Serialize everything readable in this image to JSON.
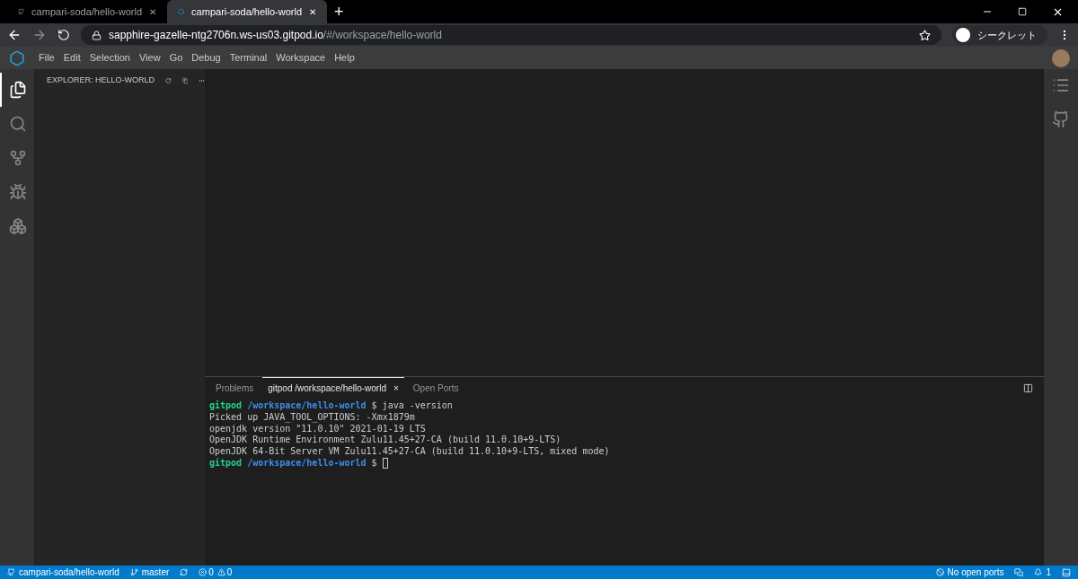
{
  "browser": {
    "tabs": [
      {
        "title": "campari-soda/hello-world",
        "kind": "github",
        "selected": false,
        "close": "✕"
      },
      {
        "title": "campari-soda/hello-world",
        "kind": "gitpod",
        "selected": true,
        "close": "✕"
      }
    ],
    "new_tab": "+",
    "url": {
      "host": "sapphire-gazelle-ntg2706n.ws-us03.gitpod.io",
      "path": "/#/workspace/hello-world"
    },
    "incognito": "シークレット"
  },
  "menu": [
    "File",
    "Edit",
    "Selection",
    "View",
    "Go",
    "Debug",
    "Terminal",
    "Workspace",
    "Help"
  ],
  "activity_bar": [
    {
      "kind": "files",
      "selected": true
    },
    {
      "kind": "search",
      "selected": false
    },
    {
      "kind": "git",
      "selected": false
    },
    {
      "kind": "debug",
      "selected": false
    },
    {
      "kind": "extensions",
      "selected": false
    }
  ],
  "sidebar": {
    "title": "EXPLORER: HELLO-WORLD"
  },
  "panel": {
    "tabs": [
      {
        "label": "Problems",
        "selected": false
      },
      {
        "label": "gitpod /workspace/hello-world",
        "selected": true,
        "close": "×"
      },
      {
        "label": "Open Ports",
        "selected": false
      }
    ],
    "terminal_cursor": true,
    "terminal": [
      [
        {
          "kind": "user",
          "text": "gitpod"
        },
        {
          "kind": "path",
          "text": "/workspace/hello-world"
        },
        {
          "kind": "text",
          "text": "$ java -version"
        }
      ],
      [
        {
          "kind": "text",
          "text": "Picked up JAVA_TOOL_OPTIONS: -Xmx1879m"
        }
      ],
      [
        {
          "kind": "text",
          "text": "openjdk version \"11.0.10\" 2021-01-19 LTS"
        }
      ],
      [
        {
          "kind": "text",
          "text": "OpenJDK Runtime Environment Zulu11.45+27-CA (build 11.0.10+9-LTS)"
        }
      ],
      [
        {
          "kind": "text",
          "text": "OpenJDK 64-Bit Server VM Zulu11.45+27-CA (build 11.0.10+9-LTS, mixed mode)"
        }
      ],
      [
        {
          "kind": "user",
          "text": "gitpod"
        },
        {
          "kind": "path",
          "text": "/workspace/hello-world"
        },
        {
          "kind": "text",
          "text": "$"
        }
      ]
    ]
  },
  "status_bar": {
    "repo": "campari-soda/hello-world",
    "branch": "master",
    "errors": "0",
    "warnings": "0",
    "ports": "No open ports",
    "notifications": "1"
  }
}
